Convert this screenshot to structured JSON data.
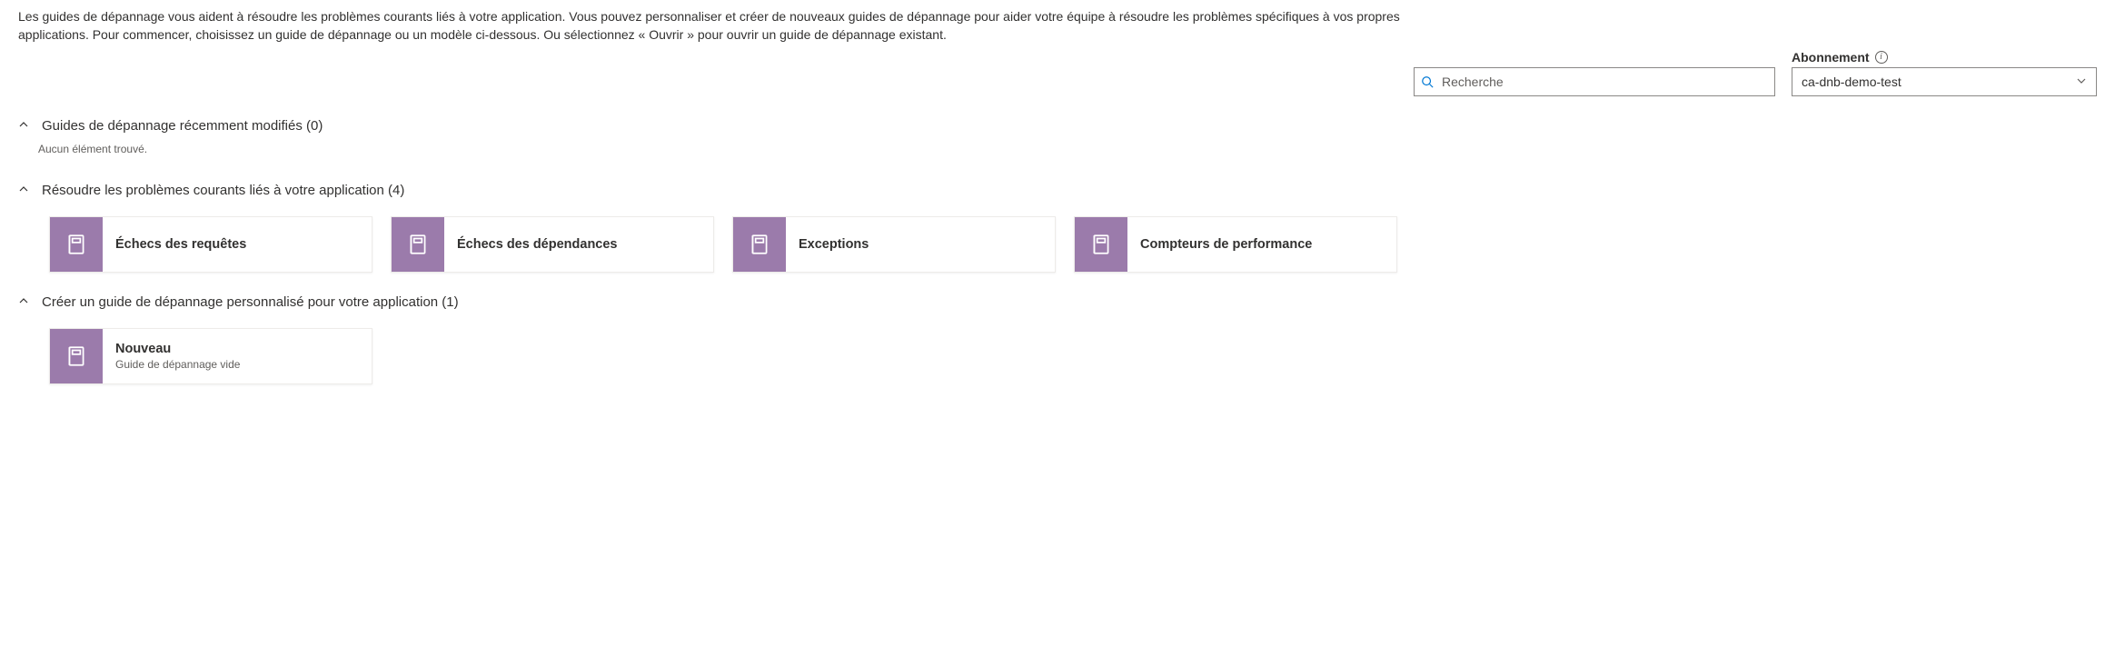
{
  "description": "Les guides de dépannage vous aident à résoudre les problèmes courants liés à votre application. Vous pouvez personnaliser et créer de nouveaux guides de dépannage pour aider votre équipe à résoudre les problèmes spécifiques à vos propres applications. Pour commencer, choisissez un guide de dépannage ou un modèle ci-dessous. Ou sélectionnez « Ouvrir » pour ouvrir un guide de dépannage existant.",
  "search": {
    "placeholder": "Recherche"
  },
  "subscription": {
    "label": "Abonnement",
    "value": "ca-dnb-demo-test"
  },
  "sections": {
    "recent": {
      "title": "Guides de dépannage récemment modifiés (0)",
      "empty": "Aucun élément trouvé."
    },
    "common": {
      "title": "Résoudre les problèmes courants liés à votre application (4)",
      "tiles": [
        {
          "title": "Échecs des requêtes"
        },
        {
          "title": "Échecs des dépendances"
        },
        {
          "title": "Exceptions"
        },
        {
          "title": "Compteurs de performance"
        }
      ]
    },
    "custom": {
      "title": "Créer un guide de dépannage personnalisé pour votre application (1)",
      "tiles": [
        {
          "title": "Nouveau",
          "subtitle": "Guide de dépannage vide"
        }
      ]
    }
  }
}
